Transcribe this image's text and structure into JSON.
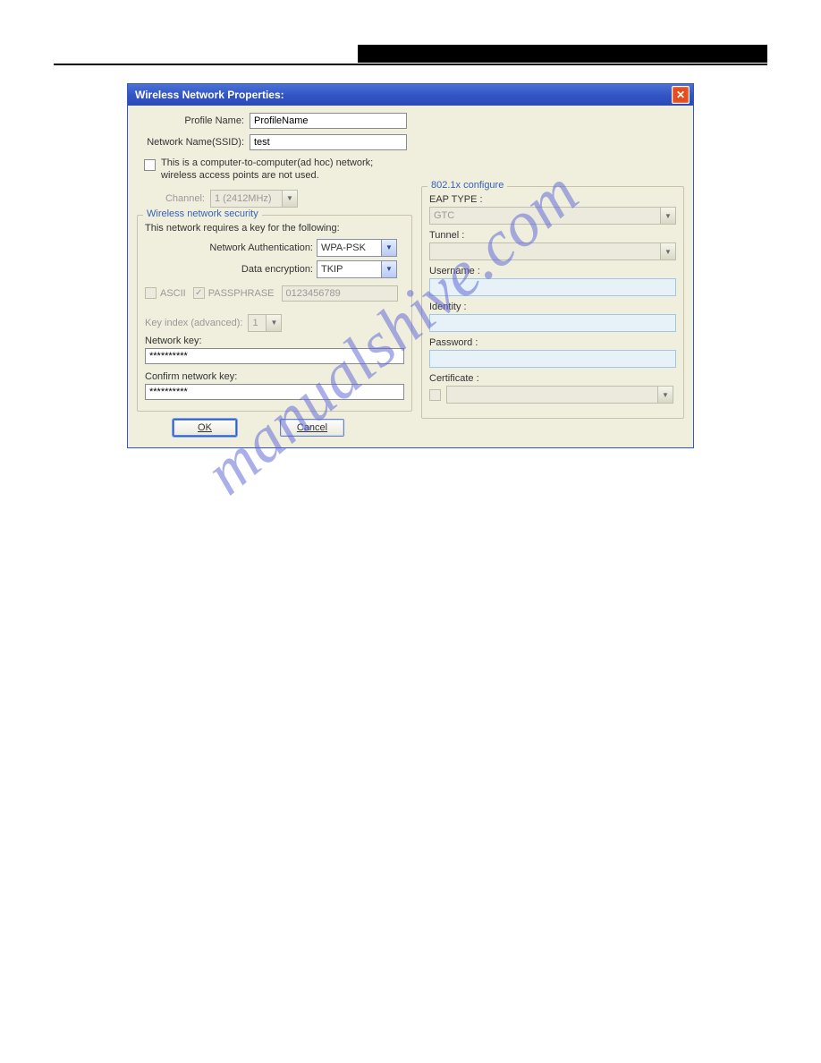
{
  "watermark": "manualshive.com",
  "titlebar": {
    "title": "Wireless Network Properties:"
  },
  "left": {
    "profile_label": "Profile Name:",
    "profile_value": "ProfileName",
    "ssid_label": "Network Name(SSID):",
    "ssid_value": "test",
    "adhoc_text": "This is a computer-to-computer(ad hoc) network; wireless access points are not used.",
    "channel_label": "Channel:",
    "channel_value": "1 (2412MHz)",
    "security_legend": "Wireless network security",
    "security_note": "This network requires a key for the following:",
    "auth_label": "Network Authentication:",
    "auth_value": "WPA-PSK",
    "enc_label": "Data encryption:",
    "enc_value": "TKIP",
    "ascii_label": "ASCII",
    "passphrase_label": "PASSPHRASE",
    "passphrase_value": "0123456789",
    "key_index_label": "Key index (advanced):",
    "key_index_value": "1",
    "network_key_label": "Network key:",
    "network_key_value": "**********",
    "confirm_key_label": "Confirm network key:",
    "confirm_key_value": "**********"
  },
  "right": {
    "legend": "802.1x configure",
    "eap_label": "EAP TYPE :",
    "eap_value": "GTC",
    "tunnel_label": "Tunnel :",
    "tunnel_value": "",
    "username_label": "Username :",
    "username_value": "",
    "identity_label": "Identity :",
    "identity_value": "",
    "password_label": "Password :",
    "password_value": "",
    "certificate_label": "Certificate :",
    "certificate_value": ""
  },
  "buttons": {
    "ok": "OK",
    "cancel": "Cancel"
  }
}
